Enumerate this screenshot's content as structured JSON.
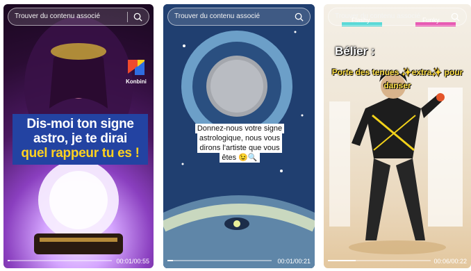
{
  "search": {
    "placeholder": "Trouver du contenu associé"
  },
  "cards": [
    {
      "brand": "Konbini",
      "title_white": "Dis-moi ton signe astro, je te dirai",
      "title_yellow": "quel rappeur tu es !",
      "time": "00:01/00:55",
      "progress": 0.02
    },
    {
      "caption": "Donnez-nous votre signe astrologique, nous vous dirons l'artiste que vous êtes 😉🔍",
      "time": "00:01/00:21",
      "progress": 0.05
    },
    {
      "heading": "Bélier :",
      "subtitle": "Porte des tenues ✨extra✨ pour danser",
      "tag_left": "Flashy",
      "tag_right": "Funky",
      "time": "00:06/00:22",
      "progress": 0.27
    }
  ],
  "colors": {
    "konbini_blue": "#2343a2",
    "highlight_yellow": "#ffd21f"
  }
}
